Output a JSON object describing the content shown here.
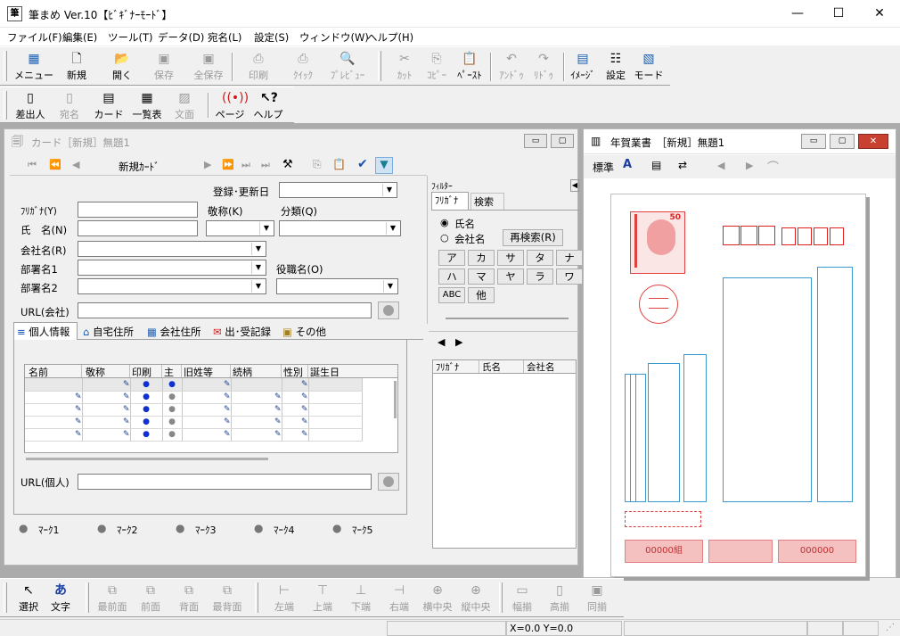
{
  "app": {
    "title": "筆まめ Ver.10【ﾋﾞｷﾞﾅｰﾓｰﾄﾞ】",
    "window_buttons": [
      "—",
      "☐",
      "✕"
    ]
  },
  "menu": [
    "ファイル(F)",
    "編集(E)",
    "ツール(T)",
    "データ(D)",
    "宛名(L)",
    "設定(S)",
    "ウィンドウ(W)",
    "ヘルプ(H)"
  ],
  "toolbar1": [
    {
      "label": "メニュー",
      "icon": "menu-icon"
    },
    {
      "label": "新規",
      "icon": "new-icon"
    },
    {
      "label": "開く",
      "icon": "open-icon"
    },
    {
      "label": "保存",
      "icon": "save-icon"
    },
    {
      "label": "全保存",
      "icon": "save-all-icon"
    },
    {
      "label": "印刷",
      "icon": "print-icon"
    },
    {
      "label": "ｸｲｯｸ",
      "icon": "quick-print-icon"
    },
    {
      "label": "ﾌﾟﾚﾋﾞｭｰ",
      "icon": "preview-icon"
    },
    {
      "label": "ｶｯﾄ",
      "icon": "cut-icon"
    },
    {
      "label": "ｺﾋﾟｰ",
      "icon": "copy-icon"
    },
    {
      "label": "ﾍﾟｰｽﾄ",
      "icon": "paste-icon"
    },
    {
      "label": "ｱﾝﾄﾞｩ",
      "icon": "undo-icon"
    },
    {
      "label": "ﾘﾄﾞｩ",
      "icon": "redo-icon"
    },
    {
      "label": "ｲﾒｰｼﾞ",
      "icon": "image-icon"
    },
    {
      "label": "設定",
      "icon": "settings-icon"
    },
    {
      "label": "モード",
      "icon": "mode-icon"
    }
  ],
  "toolbar2": [
    {
      "label": "差出人",
      "icon": "sender-icon"
    },
    {
      "label": "宛名",
      "icon": "address-icon"
    },
    {
      "label": "カード",
      "icon": "card-icon"
    },
    {
      "label": "一覧表",
      "icon": "list-icon"
    },
    {
      "label": "文面",
      "icon": "text-face-icon"
    },
    {
      "label": "ページ",
      "icon": "page-icon"
    },
    {
      "label": "ヘルプ",
      "icon": "help-icon"
    }
  ],
  "card_window": {
    "title": "カード［新規］無題1",
    "nav_label": "新規ｶｰﾄﾞ",
    "fields": {
      "registered_date": "登録･更新日",
      "furigana": "ﾌﾘｶﾞﾅ(Y)",
      "name": "氏　名(N)",
      "honorific": "敬称(K)",
      "category": "分類(Q)",
      "company": "会社名(R)",
      "dept1": "部署名1",
      "dept2": "部署名2",
      "position": "役職名(O)",
      "url_company": "URL(会社)",
      "url_personal": "URL(個人)"
    },
    "tabs": [
      "個人情報",
      "自宅住所",
      "会社住所",
      "出･受記録",
      "その他"
    ],
    "grid_headers": [
      "名前",
      "敬称",
      "印刷",
      "主",
      "旧姓等",
      "続柄",
      "性別",
      "誕生日"
    ],
    "marks": [
      "ﾏｰｸ1",
      "ﾏｰｸ2",
      "ﾏｰｸ3",
      "ﾏｰｸ4",
      "ﾏｰｸ5"
    ]
  },
  "filter_panel": {
    "title": "ﾌｨﾙﾀｰ",
    "tabs": [
      "ﾌﾘｶﾞﾅ",
      "検索"
    ],
    "radio_name": "氏名",
    "radio_company": "会社名",
    "research_button": "再検索(R)",
    "kana_buttons": [
      "ア",
      "カ",
      "サ",
      "タ",
      "ナ",
      "ハ",
      "マ",
      "ヤ",
      "ラ",
      "ワ",
      "ABC",
      "他"
    ],
    "list_headers": [
      "ﾌﾘｶﾞﾅ",
      "氏名",
      "会社名"
    ]
  },
  "nenga_window": {
    "title": "年賀業書　［新規］無題1",
    "tools": [
      "標準",
      "A",
      "レイアウト",
      "差替",
      "前",
      "次",
      "回転"
    ],
    "stamp_value": "50",
    "lottery_text": [
      "00000組",
      "000000"
    ]
  },
  "bottom_toolbar": [
    {
      "label": "選択",
      "icon": "select-arrow-icon",
      "enabled": true
    },
    {
      "label": "文字",
      "icon": "text-tool-icon",
      "enabled": true
    },
    {
      "label": "最前面",
      "icon": "bring-front-icon",
      "enabled": false
    },
    {
      "label": "前面",
      "icon": "bring-forward-icon",
      "enabled": false
    },
    {
      "label": "背面",
      "icon": "send-backward-icon",
      "enabled": false
    },
    {
      "label": "最背面",
      "icon": "send-back-icon",
      "enabled": false
    },
    {
      "label": "左端",
      "icon": "align-left-icon",
      "enabled": false
    },
    {
      "label": "上端",
      "icon": "align-top-icon",
      "enabled": false
    },
    {
      "label": "下端",
      "icon": "align-bottom-icon",
      "enabled": false
    },
    {
      "label": "右端",
      "icon": "align-right-icon",
      "enabled": false
    },
    {
      "label": "横中央",
      "icon": "align-hcenter-icon",
      "enabled": false
    },
    {
      "label": "縦中央",
      "icon": "align-vcenter-icon",
      "enabled": false
    },
    {
      "label": "幅揃",
      "icon": "same-width-icon",
      "enabled": false
    },
    {
      "label": "高揃",
      "icon": "same-height-icon",
      "enabled": false
    },
    {
      "label": "同揃",
      "icon": "same-size-icon",
      "enabled": false
    }
  ],
  "statusbar": {
    "coords": "X=0.0 Y=0.0"
  }
}
